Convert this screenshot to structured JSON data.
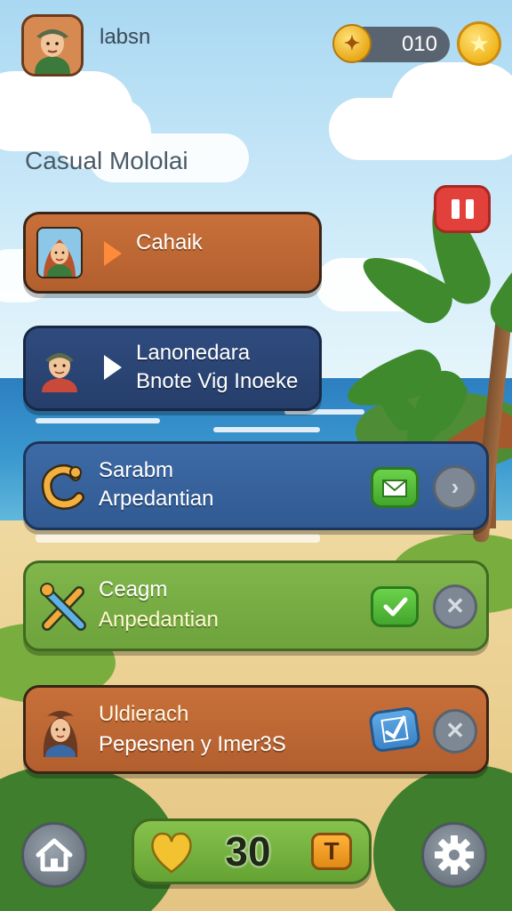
{
  "player": {
    "name": "labsn",
    "avatar_icon": "player-avatar-icon"
  },
  "currency": {
    "value": "010",
    "coin_icon": "coin-icon",
    "star_icon": "star-icon"
  },
  "mode_title": "Casual Mololai",
  "pause_icon": "pause-icon",
  "cards": [
    {
      "line1": "Cahaik",
      "icon": "woman-portrait-icon",
      "style": "orange"
    },
    {
      "line1": "Lanonedara",
      "line2": "Bnote Vig Inoeke",
      "icon": "man-portrait-icon",
      "style": "navy"
    },
    {
      "line1": "Sarabm",
      "line2": "Arpedantian",
      "icon": "hook-icon",
      "action_icon": "mail-icon",
      "secondary_icon": "arrow-right-icon",
      "style": "blue"
    },
    {
      "line1": "Ceagm",
      "line2": "Anpedantian",
      "icon": "tools-icon",
      "action_icon": "check-icon",
      "secondary_icon": "close-icon",
      "style": "green"
    },
    {
      "line1": "Uldierach",
      "line2": "Pepesnen y Imer3S",
      "icon": "girl-portrait-icon",
      "action_icon": "check-box-icon",
      "secondary_icon": "close-icon",
      "style": "orange"
    }
  ],
  "bottom_bar": {
    "home_icon": "home-icon",
    "heart_icon": "heart-icon",
    "stat_value": "30",
    "badge_letter": "T",
    "settings_icon": "gear-icon"
  },
  "colors": {
    "orange_card": "#c8703a",
    "navy_card": "#2f4b7e",
    "blue_card": "#3d6aa6",
    "green_card": "#80b64a",
    "pause_red": "#e2403a",
    "coin_gold": "#f0b51c"
  }
}
